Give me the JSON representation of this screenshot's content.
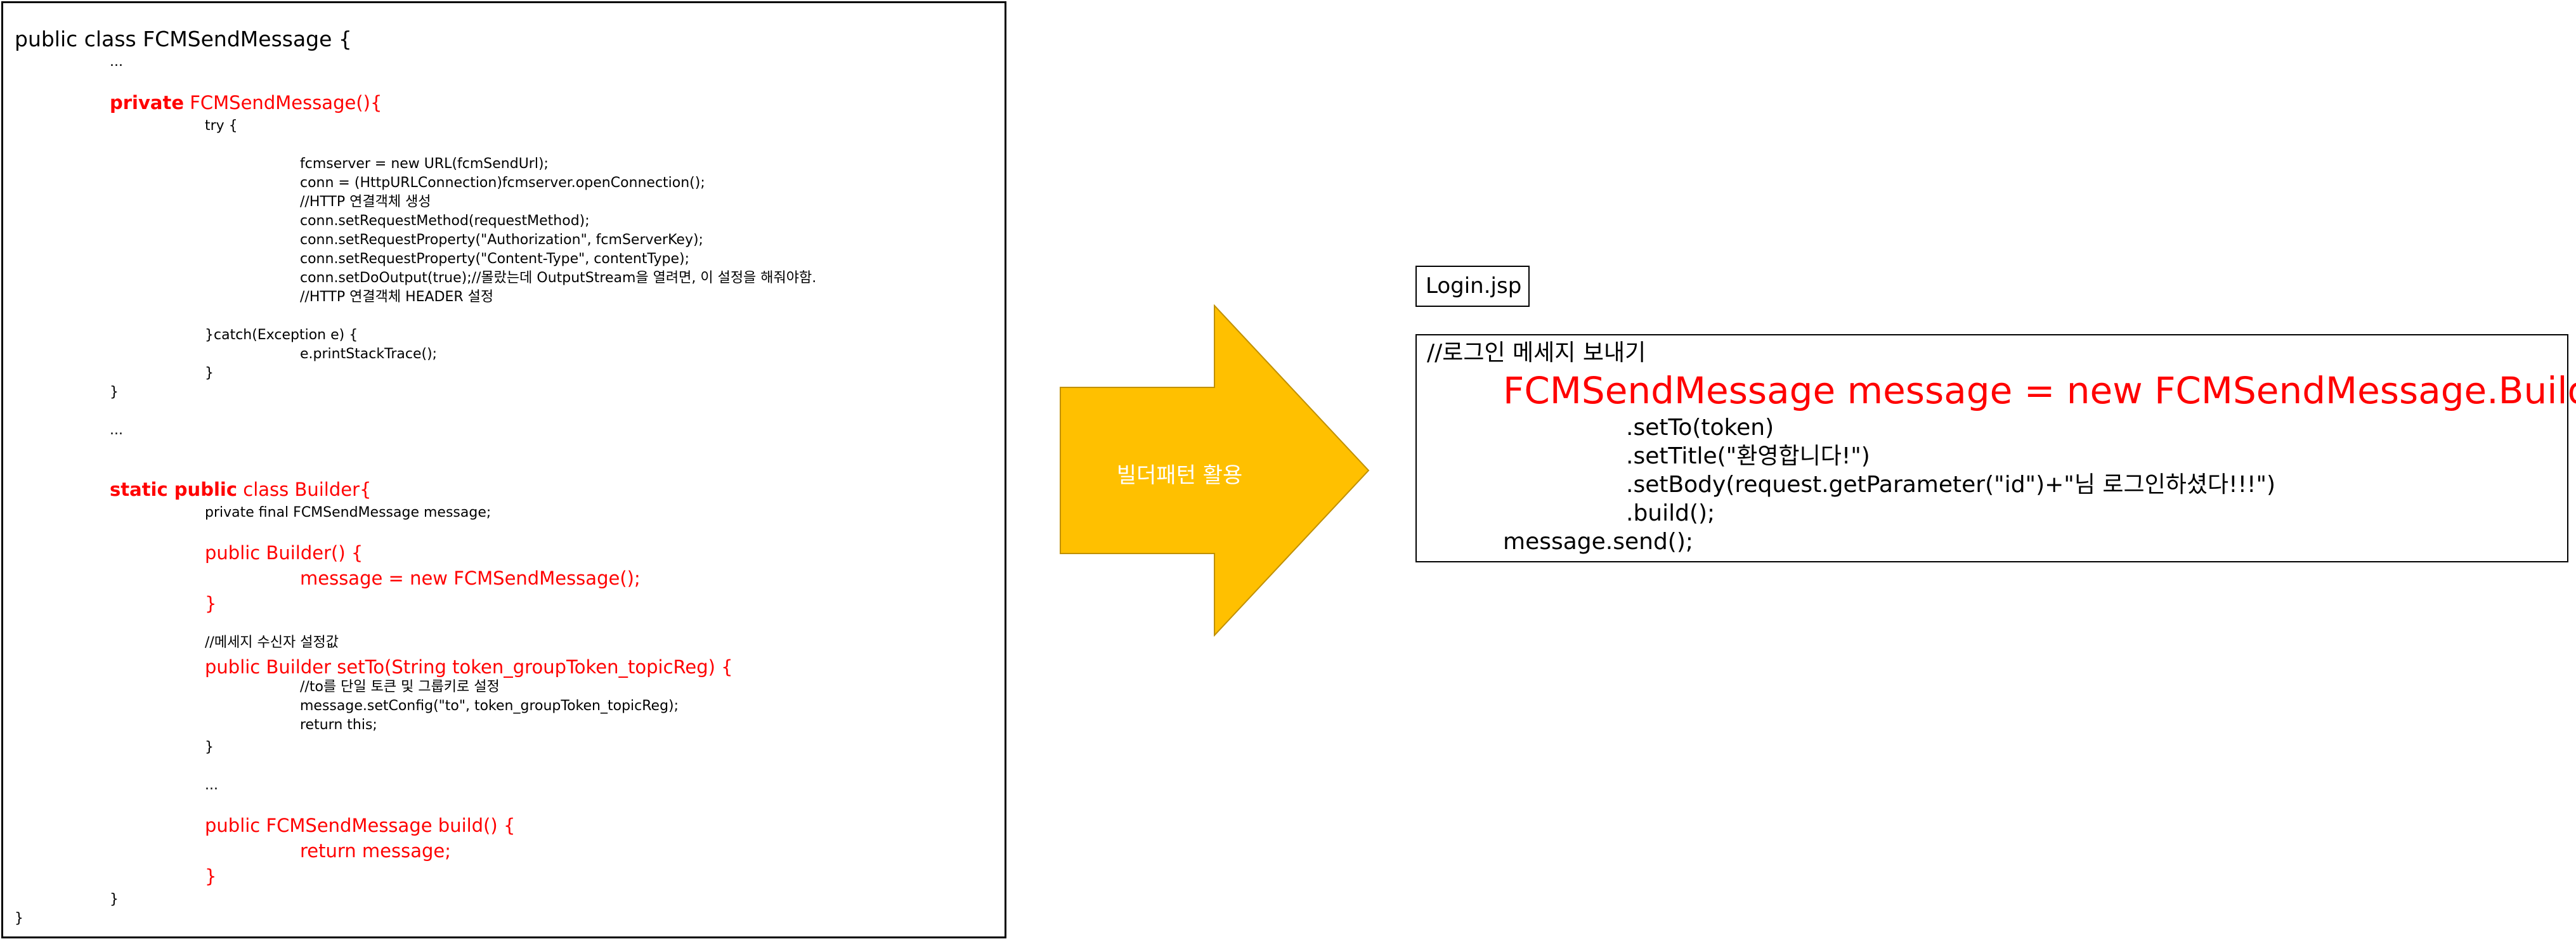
{
  "code_panel": {
    "line_class": "public class FCMSendMessage {",
    "ellipsis_1": "...",
    "ctor_kw": "private",
    "ctor_name": " FCMSendMessage(){",
    "try": "try {",
    "fcm_url": "fcmserver = new URL(fcmSendUrl);",
    "conn_open": "conn = (HttpURLConnection)fcmserver.openConnection();",
    "comment_http_obj": "//HTTP 연결객체 생성",
    "set_method": "conn.setRequestMethod(requestMethod);",
    "set_auth": "conn.setRequestProperty(\"Authorization\", fcmServerKey);",
    "set_ctype": "conn.setRequestProperty(\"Content-Type\", contentType);",
    "set_output": "conn.setDoOutput(true);//몰랐는데 OutputStream을 열려면, 이 설정을 해줘야함.",
    "comment_header": "//HTTP 연결객체 HEADER 설정",
    "catch": "}catch(Exception e) {",
    "print_trace": "e.printStackTrace();",
    "close_catch": "}",
    "close_ctor": "}",
    "ellipsis_2": "...",
    "builder_kw": "static public",
    "builder_name": " class Builder{",
    "builder_field": "private final FCMSendMessage message;",
    "builder_ctor": "public Builder() {",
    "builder_ctor_body": "message = new FCMSendMessage();",
    "builder_ctor_close": "}",
    "comment_receiver": "//메세지 수신자 설정값",
    "set_to_sig": "public Builder setTo(String token_groupToken_topicReg) {",
    "comment_to": "//to를 단일 토큰 및 그룹키로 설정",
    "set_config": "message.setConfig(\"to\", token_groupToken_topicReg);",
    "return_this": "return this;",
    "set_to_close": "}",
    "ellipsis_3": "...",
    "build_sig": "public FCMSendMessage build() {",
    "build_body": "return message;",
    "build_close": "}",
    "builder_close": "}",
    "class_close": "}"
  },
  "arrow": {
    "label": "빌더패턴 활용",
    "color": "#FFC000"
  },
  "login_panel": {
    "file_label": "Login.jsp",
    "comment": "//로그인 메세지 보내기",
    "create": "FCMSendMessage message = new FCMSendMessage.Builder()",
    "set_to": ".setTo(token)",
    "set_title": ".setTitle(\"환영합니다!\")",
    "set_body": ".setBody(request.getParameter(\"id\")+\"님 로그인하셨다!!!\")",
    "build": ".build();",
    "send": "message.send();"
  },
  "colors": {
    "highlight_red": "#FF0000",
    "arrow_fill": "#FFC000"
  }
}
